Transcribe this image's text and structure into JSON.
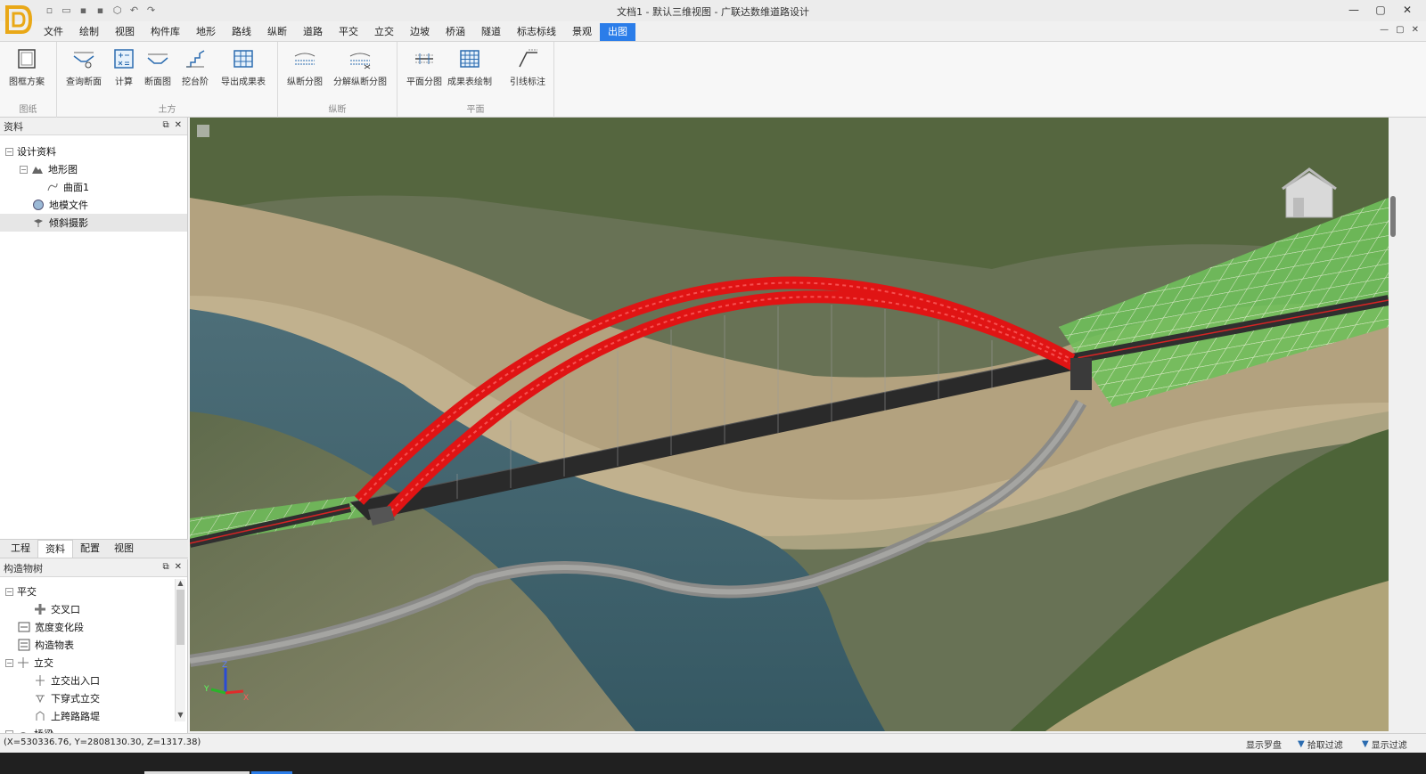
{
  "window": {
    "title": "文档1 - 默认三维视图 - 广联达数维道路设计",
    "controls": [
      "—",
      "▢",
      "✕"
    ],
    "mdi_controls": [
      "—",
      "▢",
      "✕"
    ]
  },
  "quick_access": [
    "new-icon",
    "open-icon",
    "save-icon",
    "save-as-icon",
    "cube-icon",
    "undo-icon",
    "redo-icon"
  ],
  "menu": [
    "文件",
    "绘制",
    "视图",
    "构件库",
    "地形",
    "路线",
    "纵断",
    "道路",
    "平交",
    "立交",
    "边坡",
    "桥涵",
    "隧道",
    "标志标线",
    "景观",
    "出图"
  ],
  "menu_active": "出图",
  "ribbon": {
    "groups": [
      {
        "label": "图纸",
        "buttons": [
          "图框方案"
        ]
      },
      {
        "label": "土方",
        "buttons": [
          "查询断面",
          "计算",
          "断面图",
          "挖台阶",
          "导出成果表"
        ]
      },
      {
        "label": "纵断",
        "buttons": [
          "纵断分图",
          "分解纵断分图"
        ]
      },
      {
        "label": "平面",
        "buttons": [
          "平面分图",
          "成果表绘制",
          "引线标注"
        ]
      }
    ]
  },
  "panels": {
    "data_panel": {
      "title": "资料",
      "tree": [
        {
          "label": "设计资料",
          "level": 0,
          "toggle": "−"
        },
        {
          "label": "地形图",
          "level": 1,
          "toggle": "−"
        },
        {
          "label": "曲面1",
          "level": 2
        },
        {
          "label": "地模文件",
          "level": 1
        },
        {
          "label": "倾斜摄影",
          "level": 1,
          "selected": true
        }
      ],
      "tabs": [
        "工程",
        "资料",
        "配置",
        "视图"
      ],
      "active_tab": "资料"
    },
    "structures_panel": {
      "title": "构造物树",
      "tree": [
        {
          "label": "平交",
          "level": 0,
          "toggle": "−"
        },
        {
          "label": "交叉口",
          "level": 1
        },
        {
          "label": "宽度变化段",
          "level": 0
        },
        {
          "label": "构造物表",
          "level": 0
        },
        {
          "label": "立交",
          "level": 0,
          "toggle": "−"
        },
        {
          "label": "立交出入口",
          "level": 1
        },
        {
          "label": "下穿式立交",
          "level": 1
        },
        {
          "label": "上跨路路堤",
          "level": 1
        },
        {
          "label": "桥梁",
          "level": 0,
          "toggle": "−"
        }
      ]
    }
  },
  "status": {
    "coords": "(X=530336.76, Y=2808130.30, Z=1317.38)",
    "buttons": [
      "显示罗盘",
      "拾取过滤",
      "显示过滤"
    ]
  },
  "axis_triad": {
    "x": "X",
    "y": "Y",
    "z": "Z"
  },
  "colors": {
    "accent": "#2b7de9",
    "arch": "#e01414",
    "deck": "#2a2a2a",
    "terrain_grid": "#6fbf5a"
  }
}
